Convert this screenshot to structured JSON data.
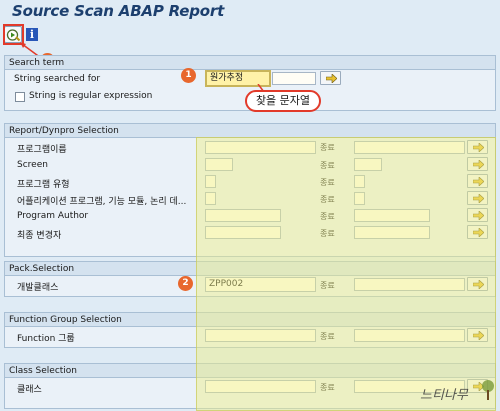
{
  "window": {
    "title": "Source Scan ABAP Report"
  },
  "toolbar": {
    "execute_icon": "execute-icon",
    "info_label": "i"
  },
  "annotations": {
    "badge_1": "1",
    "badge_2": "2",
    "badge_3": "3",
    "callout_text": "찾을 문자열"
  },
  "search_term": {
    "header": "Search term",
    "string_label": "String searched for",
    "string_value": "원가추정",
    "regex_label": "String is regular expression"
  },
  "report_dynpro": {
    "header": "Report/Dynpro Selection",
    "rows": [
      {
        "label": "프로그램이름",
        "to": "종료"
      },
      {
        "label": "Screen",
        "to": "종료"
      },
      {
        "label": "프로그램 유형",
        "to": "종료"
      },
      {
        "label": "어플리케이션 프로그램, 기능 모듈, 논리 데...",
        "to": "종료"
      },
      {
        "label": "Program Author",
        "to": "종료"
      },
      {
        "label": "최종 변경자",
        "to": "종료"
      }
    ]
  },
  "pack_selection": {
    "header": "Pack.Selection",
    "label": "개발클래스",
    "value": "ZPP002",
    "to": "종료"
  },
  "function_group": {
    "header": "Function Group Selection",
    "label": "Function 그룹",
    "to": "종료"
  },
  "class_selection": {
    "header": "Class Selection",
    "label": "클래스",
    "to": "종료"
  },
  "watermark": {
    "text": "느티나무"
  },
  "colors": {
    "accent_red": "#e23a2a",
    "badge_orange": "#e8672d",
    "highlight_yellow": "#fff2a8",
    "title_blue": "#1c3f6e"
  }
}
